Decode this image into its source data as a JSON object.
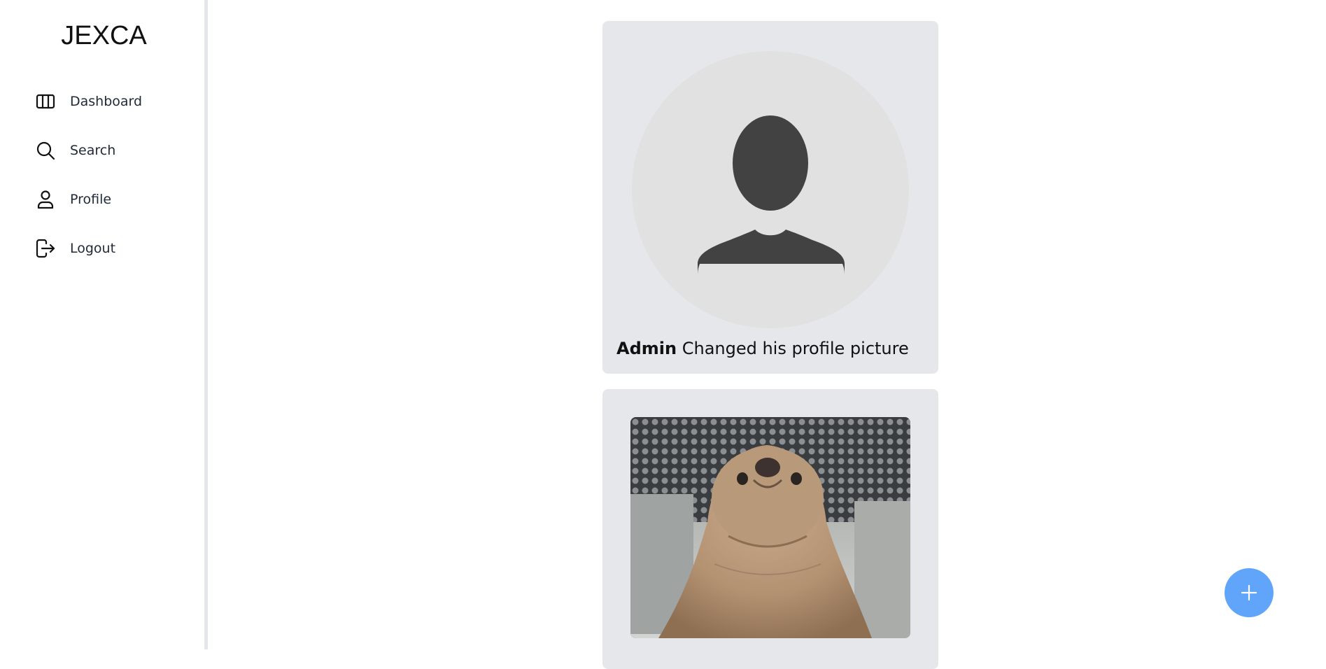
{
  "app": {
    "brand": "JEXCA"
  },
  "sidebar": {
    "items": [
      {
        "label": "Dashboard",
        "icon": "columns-icon"
      },
      {
        "label": "Search",
        "icon": "search-icon"
      },
      {
        "label": "Profile",
        "icon": "user-icon"
      },
      {
        "label": "Logout",
        "icon": "logout-icon"
      }
    ]
  },
  "feed": {
    "posts": [
      {
        "author": "Admin",
        "action": "Changed his profile picture",
        "media": "default-avatar-icon"
      },
      {
        "media": "sea-lion-photo"
      }
    ]
  },
  "fab": {
    "icon": "plus-icon"
  },
  "colors": {
    "accent": "#60a5fa",
    "card_bg": "#e5e7eb",
    "sidebar_border": "#e5e7eb",
    "avatar_fg": "#424242"
  }
}
